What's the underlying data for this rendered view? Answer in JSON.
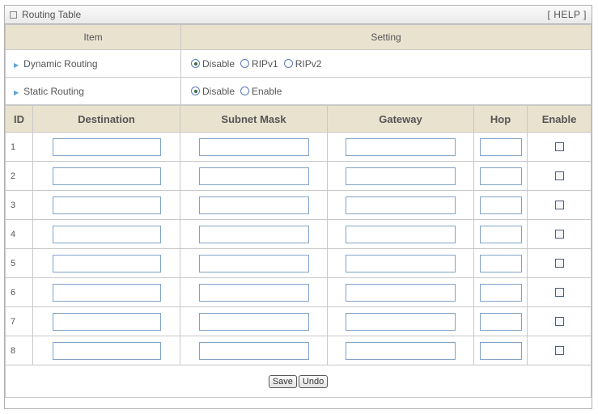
{
  "title": "Routing Table",
  "help": "[ HELP ]",
  "headers": {
    "item": "Item",
    "setting": "Setting"
  },
  "dynamic": {
    "label": "Dynamic Routing",
    "options": [
      "Disable",
      "RIPv1",
      "RIPv2"
    ],
    "selected": "Disable"
  },
  "static": {
    "label": "Static Routing",
    "options": [
      "Disable",
      "Enable"
    ],
    "selected": "Disable"
  },
  "columns": {
    "id": "ID",
    "destination": "Destination",
    "subnet": "Subnet Mask",
    "gateway": "Gateway",
    "hop": "Hop",
    "enable": "Enable"
  },
  "rows": [
    {
      "id": "1",
      "destination": "",
      "subnet": "",
      "gateway": "",
      "hop": "",
      "enabled": false
    },
    {
      "id": "2",
      "destination": "",
      "subnet": "",
      "gateway": "",
      "hop": "",
      "enabled": false
    },
    {
      "id": "3",
      "destination": "",
      "subnet": "",
      "gateway": "",
      "hop": "",
      "enabled": false
    },
    {
      "id": "4",
      "destination": "",
      "subnet": "",
      "gateway": "",
      "hop": "",
      "enabled": false
    },
    {
      "id": "5",
      "destination": "",
      "subnet": "",
      "gateway": "",
      "hop": "",
      "enabled": false
    },
    {
      "id": "6",
      "destination": "",
      "subnet": "",
      "gateway": "",
      "hop": "",
      "enabled": false
    },
    {
      "id": "7",
      "destination": "",
      "subnet": "",
      "gateway": "",
      "hop": "",
      "enabled": false
    },
    {
      "id": "8",
      "destination": "",
      "subnet": "",
      "gateway": "",
      "hop": "",
      "enabled": false
    }
  ],
  "buttons": {
    "save": "Save",
    "undo": "Undo"
  }
}
